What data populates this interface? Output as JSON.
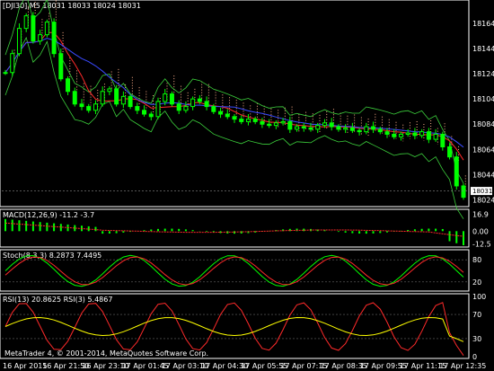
{
  "main": {
    "title": "[DJI30],M5  18031 18033 18024 18031",
    "y_ticks": [
      "18164",
      "18144",
      "18124",
      "18104",
      "18084",
      "18064",
      "18044",
      "18024"
    ],
    "y_tick_values": [
      18164,
      18144,
      18124,
      18104,
      18084,
      18064,
      18044,
      18024
    ],
    "y_range": [
      18020,
      18174
    ],
    "current_price": "18031",
    "current_price_value": 18031,
    "colors": {
      "bull": "#00ff00",
      "bear": "#00ff00",
      "ma_red": "#ff2a2a",
      "ma_blue": "#3a4aff",
      "band": "#3ccf3c",
      "cloud": "#ffb08a"
    }
  },
  "macd": {
    "title": "MACD(12,26,9) -11.2 -3.7",
    "y_ticks": [
      "16.9",
      "0.00",
      "-12.5"
    ],
    "y_tick_values": [
      16.9,
      0,
      -12.5
    ],
    "y_range": [
      -14,
      19
    ]
  },
  "stoch": {
    "title": "Stoch(8,3,3) 8.2873 7.4495",
    "y_ticks": [
      "80",
      "20"
    ],
    "y_tick_values": [
      80,
      20
    ],
    "y_range": [
      0,
      100
    ]
  },
  "rsi": {
    "title": "RSI(13) 20.8625  RSI(3) 5.4867",
    "y_ticks": [
      "100",
      "70",
      "30",
      "0"
    ],
    "y_tick_values": [
      100,
      70,
      30,
      0
    ],
    "y_range": [
      0,
      100
    ]
  },
  "footer": {
    "copyright": "MetaTrader 4, © 2001-2014, MetaQuotes Software Corp."
  },
  "x_axis": {
    "labels": [
      "16 Apr 2015",
      "16 Apr 21:50",
      "16 Apr 23:10",
      "17 Apr 01:45",
      "17 Apr 03:10",
      "17 Apr 04:30",
      "17 Apr 05:55",
      "17 Apr 07:15",
      "17 Apr 08:35",
      "17 Apr 09:55",
      "17 Apr 11:15",
      "17 Apr 12:35"
    ]
  },
  "chart_data": {
    "type": "candlestick",
    "description_series": [
      {
        "name": "close",
        "values": [
          18125,
          18140,
          18160,
          18170,
          18150,
          18155,
          18165,
          18140,
          18120,
          18110,
          18100,
          18098,
          18095,
          18100,
          18110,
          18112,
          18100,
          18106,
          18098,
          18095,
          18092,
          18090,
          18102,
          18108,
          18100,
          18095,
          18098,
          18104,
          18102,
          18098,
          18094,
          18092,
          18090,
          18088,
          18086,
          18088,
          18086,
          18084,
          18083,
          18085,
          18086,
          18080,
          18082,
          18081,
          18080,
          18083,
          18085,
          18082,
          18080,
          18081,
          18079,
          18078,
          18082,
          18080,
          18078,
          18076,
          18074,
          18076,
          18077,
          18075,
          18078,
          18072,
          18076,
          18066,
          18058,
          18035,
          18026
        ]
      }
    ]
  }
}
